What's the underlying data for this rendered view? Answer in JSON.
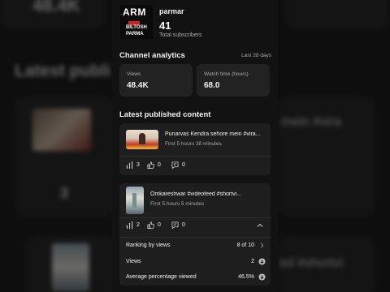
{
  "background": {
    "top_value": "48.4K",
    "heading": "Latest publi",
    "views": "3",
    "right_text_1": "mein #vira",
    "right_text_2": "ed #shortvi"
  },
  "channel": {
    "logo_text": "ARM",
    "logo_line1": "BILTOSH",
    "logo_line2": "PARMA",
    "name": "parmar",
    "subscribers": "41",
    "subscribers_label": "Total subscribers"
  },
  "analytics": {
    "title": "Channel analytics",
    "period": "Last 28 days",
    "views_label": "Views",
    "views_value": "48.4K",
    "watch_label": "Watch time (hours)",
    "watch_value": "68.0"
  },
  "latest": {
    "title": "Latest published content",
    "videos": [
      {
        "title": "Punarvas Kendra sehore mein #vira...",
        "meta": "First 5 hours 38 minutes",
        "views": "3",
        "likes": "0",
        "comments": "0"
      },
      {
        "title": "Omkareshwar #videofeed #shortvi...",
        "meta": "First 5 hours 5 minutes",
        "views": "2",
        "likes": "0",
        "comments": "0",
        "details": {
          "rank_label": "Ranking by views",
          "rank_value": "8 of 10",
          "views_label": "Views",
          "views_value": "2",
          "avg_label": "Average percentage viewed",
          "avg_value": "46.5%"
        }
      }
    ]
  },
  "colors": {
    "panel": "#121212",
    "card": "#222222",
    "text": "#f1f1f1",
    "secondary": "#aaaaaa"
  }
}
